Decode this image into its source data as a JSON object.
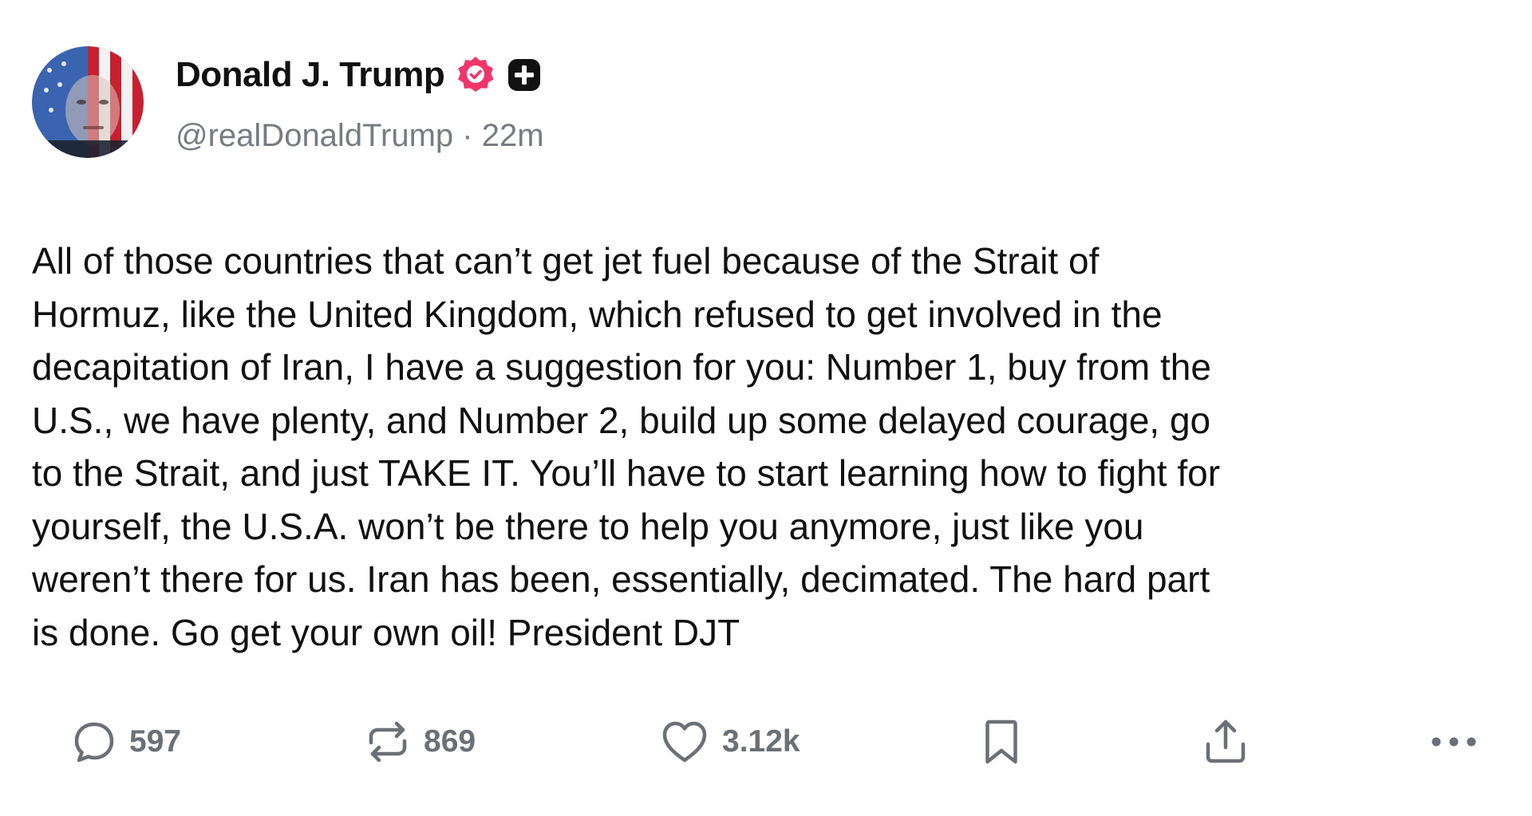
{
  "author": {
    "name": "Donald J. Trump",
    "handle": "@realDonaldTrump",
    "separator": "·",
    "time": "22m",
    "avatar_icon": "flag-portrait-avatar",
    "verified_icon": "verified-badge-icon",
    "verified_color": "#f0356b",
    "plus_icon": "plus-badge-icon"
  },
  "post": {
    "text": "All of those countries that can’t get jet fuel because of the Strait of\nHormuz, like the United Kingdom, which refused to get involved in the\ndecapitation of Iran, I have a suggestion for you: Number 1, buy from the\nU.S., we have plenty, and Number 2, build up some delayed courage, go\nto the Strait, and just TAKE IT. You’ll have to start learning how to fight for\nyourself, the U.S.A. won’t be there to help you anymore, just like you\nweren’t there for us. Iran has been, essentially, decimated. The hard part\nis done. Go get your own oil! President DJT"
  },
  "actions": {
    "replies": {
      "count": "597",
      "icon": "reply-icon"
    },
    "retruths": {
      "count": "869",
      "icon": "retruth-icon"
    },
    "likes": {
      "count": "3.12k",
      "icon": "heart-icon"
    },
    "bookmark": {
      "icon": "bookmark-icon"
    },
    "share": {
      "icon": "share-icon"
    },
    "more": {
      "icon": "more-icon"
    }
  },
  "colors": {
    "text": "#111111",
    "muted": "#777b82",
    "action": "#6b6f76",
    "accent": "#f0356b"
  }
}
